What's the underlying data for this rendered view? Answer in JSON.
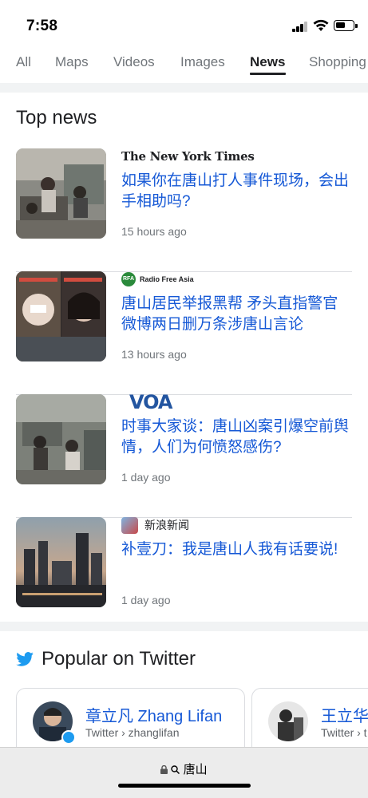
{
  "status": {
    "time": "7:58"
  },
  "tabs": [
    "All",
    "Maps",
    "Videos",
    "Images",
    "News",
    "Shopping"
  ],
  "active_tab": "News",
  "top_news": {
    "title": "Top news",
    "items": [
      {
        "source": "The New York Times",
        "headline": "如果你在唐山打人事件现场，会出手相助吗?",
        "time": "15 hours ago"
      },
      {
        "source": "Radio Free Asia",
        "source_badge": "RFA",
        "headline": "唐山居民举报黑帮 矛头直指警官 微博两日删万条涉唐山言论",
        "time": "13 hours ago"
      },
      {
        "source": "VOA",
        "headline": "时事大家谈：唐山凶案引爆空前舆情，人们为何愤怒感伤?",
        "time": "1 day ago"
      },
      {
        "source": "新浪新闻",
        "headline": "补壹刀：我是唐山人我有话要说!",
        "time": "1 day ago"
      }
    ]
  },
  "twitter": {
    "title": "Popular on Twitter",
    "cards": [
      {
        "name": "章立凡 Zhang Lifan",
        "handle": "Twitter › zhanglifan"
      },
      {
        "name": "王立华",
        "handle": "Twitter › t"
      }
    ]
  },
  "url_bar": {
    "text": "唐山"
  },
  "colors": {
    "link": "#1558d6",
    "muted": "#70757a",
    "twitter_blue": "#1d9bf0"
  }
}
